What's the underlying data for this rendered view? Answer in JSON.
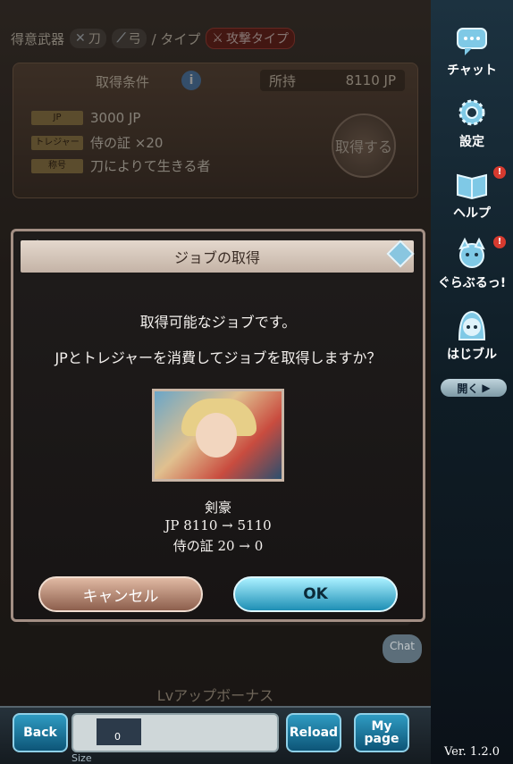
{
  "weapon_row": {
    "label": "得意武器",
    "weapon1": "刀",
    "weapon2": "弓",
    "type_label": "/ タイプ",
    "type_value": "攻撃タイプ"
  },
  "conditions": {
    "title": "取得条件",
    "owned_label": "所持",
    "owned_value": "8110 JP",
    "rows": [
      {
        "tag": "JP",
        "value": "3000 JP"
      },
      {
        "tag": "トレジャー",
        "value": "侍の証 ×20"
      },
      {
        "tag": "称号",
        "value": "刀によりて生きる者"
      }
    ],
    "acquire_button": "取得する"
  },
  "background": {
    "chat_bubble": "Chat",
    "lv_bonus_title": "Lvアップボーナス"
  },
  "dialog": {
    "title": "ジョブの取得",
    "message1": "取得可能なジョブです。",
    "message2": "JPとトレジャーを消費してジョブを取得しますか？",
    "job_name": "剣豪",
    "jp_line": "JP 8110 → 5110",
    "treasure_line": "侍の証 20 → 0",
    "cancel_label": "キャンセル",
    "ok_label": "OK"
  },
  "bottom_bar": {
    "back_label": "Back",
    "item_count": "0",
    "reload_label": "Reload",
    "mypage_label": "My page",
    "size_label": "Size"
  },
  "sidebar": {
    "items": [
      {
        "label": "チャット",
        "icon": "chat-icon",
        "badge": ""
      },
      {
        "label": "設定",
        "icon": "gear-icon",
        "badge": ""
      },
      {
        "label": "ヘルプ",
        "icon": "book-icon",
        "badge": "!"
      },
      {
        "label": "ぐらぶるっ!",
        "icon": "character-icon",
        "badge": "!"
      },
      {
        "label": "はじブル",
        "icon": "girl-icon",
        "badge": ""
      }
    ],
    "open_label": "開く",
    "version": "Ver. 1.2.0"
  },
  "colors": {
    "ok_accent": "#1e8fb5",
    "cancel_accent": "#8d5f4d",
    "sidebar_bg": "#0f1d26"
  }
}
